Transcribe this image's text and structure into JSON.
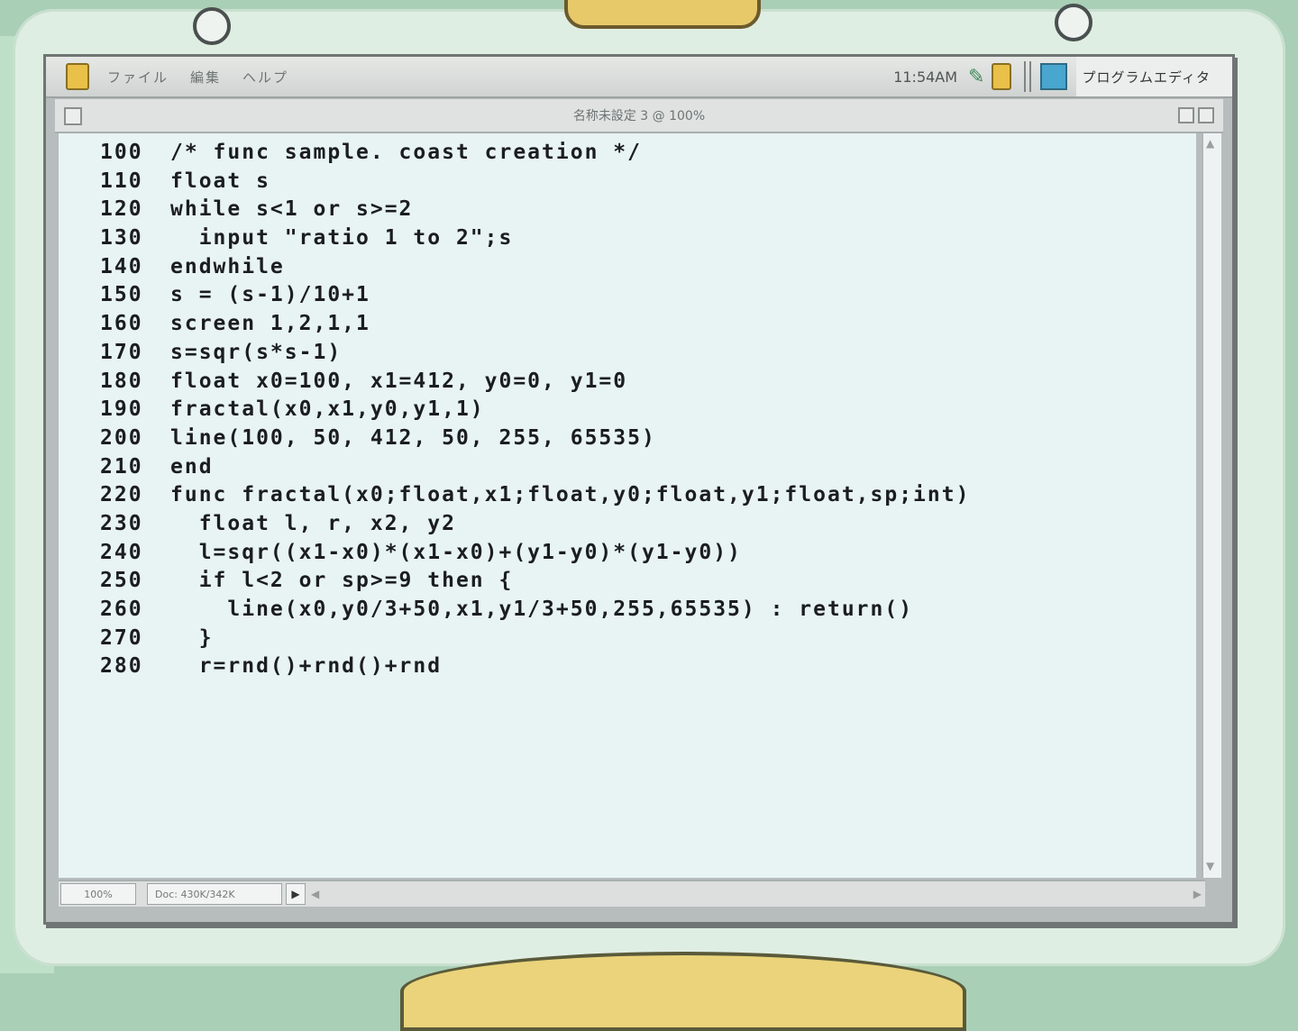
{
  "menubar": {
    "items": [
      "ファイル",
      "編集",
      "ヘルプ"
    ],
    "clock": "11:54AM",
    "app_name": "プログラムエディタ"
  },
  "window": {
    "title": "名称未設定 3 @ 100%"
  },
  "editor": {
    "lines": [
      {
        "num": "100",
        "code": "/* func sample. coast creation */"
      },
      {
        "num": "110",
        "code": "float s"
      },
      {
        "num": "120",
        "code": "while s<1 or s>=2"
      },
      {
        "num": "130",
        "code": "  input \"ratio 1 to 2\";s"
      },
      {
        "num": "140",
        "code": "endwhile"
      },
      {
        "num": "150",
        "code": "s = (s-1)/10+1"
      },
      {
        "num": "160",
        "code": "screen 1,2,1,1"
      },
      {
        "num": "170",
        "code": "s=sqr(s*s-1)"
      },
      {
        "num": "180",
        "code": "float x0=100, x1=412, y0=0, y1=0"
      },
      {
        "num": "190",
        "code": "fractal(x0,x1,y0,y1,1)"
      },
      {
        "num": "200",
        "code": "line(100, 50, 412, 50, 255, 65535)"
      },
      {
        "num": "210",
        "code": "end"
      },
      {
        "num": "220",
        "code": "func fractal(x0;float,x1;float,y0;float,y1;float,sp;int)"
      },
      {
        "num": "230",
        "code": "  float l, r, x2, y2"
      },
      {
        "num": "240",
        "code": "  l=sqr((x1-x0)*(x1-x0)+(y1-y0)*(y1-y0))"
      },
      {
        "num": "250",
        "code": "  if l<2 or sp>=9 then {"
      },
      {
        "num": "260",
        "code": "    line(x0,y0/3+50,x1,y1/3+50,255,65535) : return()"
      },
      {
        "num": "270",
        "code": "  }"
      },
      {
        "num": "280",
        "code": "  r=rnd()+rnd()+rnd"
      }
    ]
  },
  "statusbar": {
    "zoom": "100%",
    "doc": "Doc: 430K/342K"
  }
}
